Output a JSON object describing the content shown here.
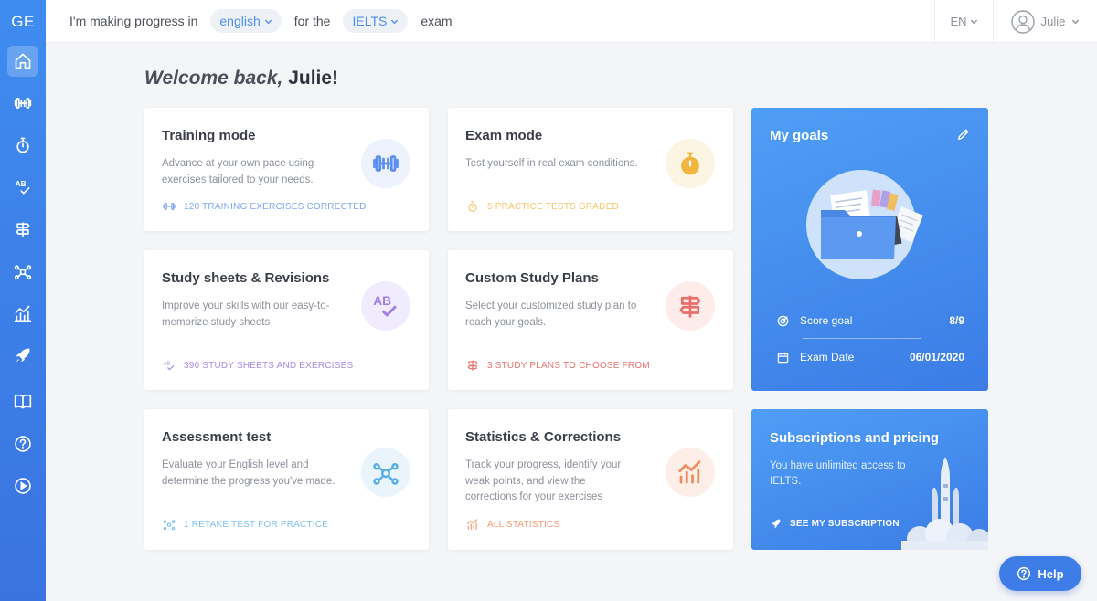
{
  "sidebar": {
    "logo": "GE",
    "items": [
      {
        "name": "home",
        "icon": "home-icon",
        "active": true
      },
      {
        "name": "training",
        "icon": "dumbbell-icon"
      },
      {
        "name": "exam",
        "icon": "stopwatch-icon"
      },
      {
        "name": "study-sheets",
        "icon": "ab-check-icon"
      },
      {
        "name": "study-plans",
        "icon": "signpost-icon"
      },
      {
        "name": "assessment",
        "icon": "network-icon"
      },
      {
        "name": "statistics",
        "icon": "chart-icon"
      },
      {
        "name": "subscription",
        "icon": "rocket-icon"
      },
      {
        "name": "library",
        "icon": "book-icon"
      },
      {
        "name": "help",
        "icon": "question-icon"
      },
      {
        "name": "tutorial",
        "icon": "play-icon"
      }
    ]
  },
  "topbar": {
    "prefix": "I'm making progress in",
    "language": "english",
    "middle": "for the",
    "exam": "IELTS",
    "suffix": "exam",
    "locale": "EN",
    "user_name": "Julie"
  },
  "welcome": {
    "greeting": "Welcome back,",
    "name": "Julie!"
  },
  "cards": {
    "training": {
      "title": "Training mode",
      "desc": "Advance at your own pace using exercises tailored to your needs.",
      "foot": "120 TRAINING EXERCISES CORRECTED",
      "icon": "dumbbell-icon",
      "color": "#5b8ff0"
    },
    "exam": {
      "title": "Exam mode",
      "desc": "Test yourself in real exam conditions.",
      "foot": "5 PRACTICE TESTS GRADED",
      "icon": "stopwatch-icon",
      "color": "#f2b640"
    },
    "study": {
      "title": "Study sheets & Revisions",
      "desc": "Improve your skills with our easy-to-memorize study sheets",
      "foot": "390 STUDY SHEETS AND EXERCISES",
      "icon": "ab-check-icon",
      "color": "#a07ee8"
    },
    "plans": {
      "title": "Custom Study Plans",
      "desc": "Select your customized study plan to reach your goals.",
      "foot": "3 STUDY PLANS TO CHOOSE FROM",
      "icon": "signpost-icon",
      "color": "#e86f6a"
    },
    "assessment": {
      "title": "Assessment test",
      "desc": "Evaluate your English level and determine the progress you've made.",
      "foot": "1 RETAKE TEST FOR PRACTICE",
      "icon": "network-icon",
      "color": "#5aaee8"
    },
    "stats": {
      "title": "Statistics & Corrections",
      "desc": "Track your progress, identify your weak points, and view the corrections for your exercises",
      "foot": "ALL STATISTICS",
      "icon": "chart-icon",
      "color": "#f28b5b"
    }
  },
  "goals": {
    "title": "My goals",
    "score_label": "Score goal",
    "score_value": "8/9",
    "date_label": "Exam Date",
    "date_value": "06/01/2020"
  },
  "subscription": {
    "title": "Subscriptions and pricing",
    "desc": "You have unlimited access to IELTS.",
    "link": "SEE MY SUBSCRIPTION"
  },
  "help": {
    "label": "Help"
  }
}
